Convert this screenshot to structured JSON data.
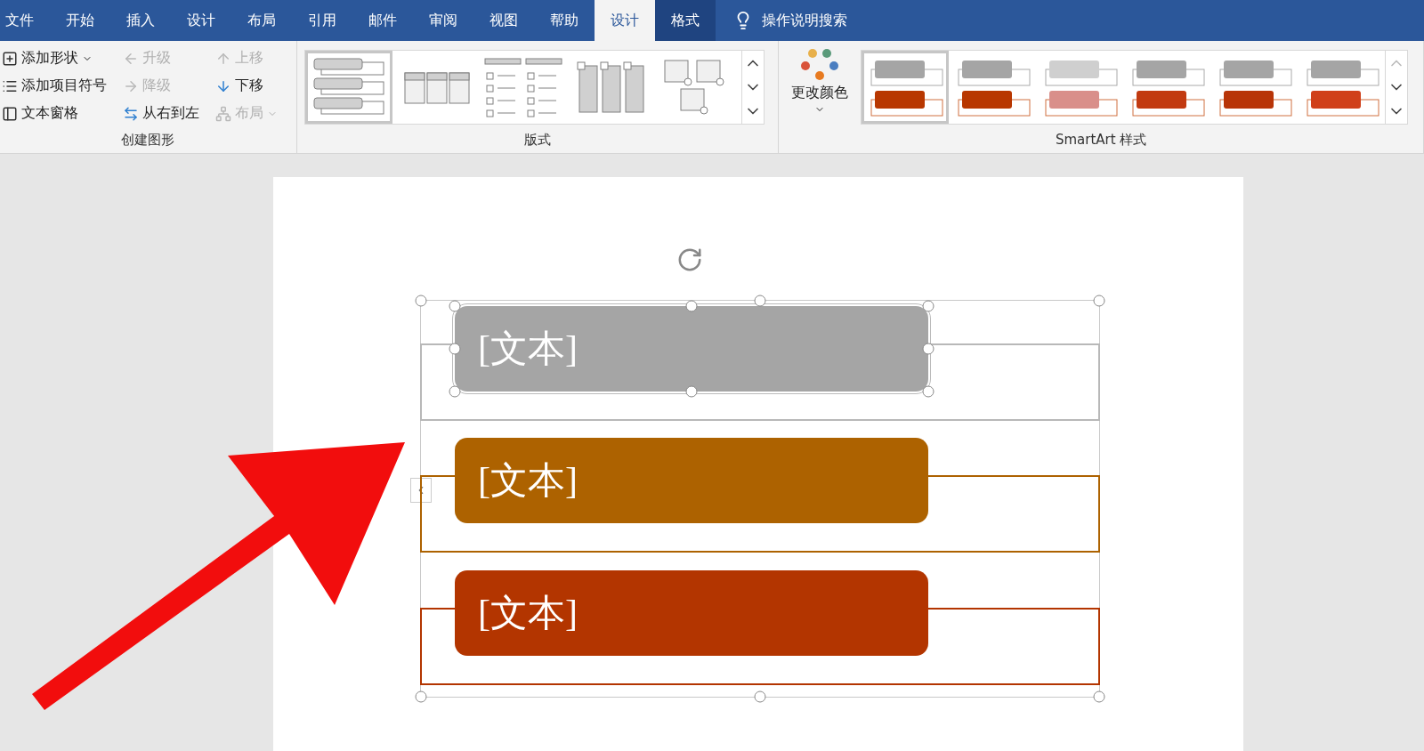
{
  "tabs": [
    {
      "label": "文件",
      "selected": false,
      "contextual": false
    },
    {
      "label": "开始",
      "selected": false,
      "contextual": false
    },
    {
      "label": "插入",
      "selected": false,
      "contextual": false
    },
    {
      "label": "设计",
      "selected": false,
      "contextual": false
    },
    {
      "label": "布局",
      "selected": false,
      "contextual": false
    },
    {
      "label": "引用",
      "selected": false,
      "contextual": false
    },
    {
      "label": "邮件",
      "selected": false,
      "contextual": false
    },
    {
      "label": "审阅",
      "selected": false,
      "contextual": false
    },
    {
      "label": "视图",
      "selected": false,
      "contextual": false
    },
    {
      "label": "帮助",
      "selected": false,
      "contextual": false
    },
    {
      "label": "设计",
      "selected": true,
      "contextual": true
    },
    {
      "label": "格式",
      "selected": false,
      "contextual": true
    }
  ],
  "search": {
    "placeholder": "操作说明搜索"
  },
  "create_graphic": {
    "label": "创建图形",
    "commands": [
      {
        "label": "添加形状",
        "disabled": false,
        "dropdown": true
      },
      {
        "label": "添加项目符号",
        "disabled": false,
        "dropdown": false
      },
      {
        "label": "文本窗格",
        "disabled": false,
        "dropdown": false
      },
      {
        "label": "升级",
        "disabled": true,
        "dropdown": false
      },
      {
        "label": "降级",
        "disabled": true,
        "dropdown": false
      },
      {
        "label": "从右到左",
        "disabled": false,
        "dropdown": false
      },
      {
        "label": "上移",
        "disabled": true,
        "dropdown": false
      },
      {
        "label": "下移",
        "disabled": false,
        "dropdown": false
      },
      {
        "label": "布局",
        "disabled": true,
        "dropdown": true
      }
    ]
  },
  "layouts": {
    "label": "版式",
    "items": [
      {
        "selected": true
      },
      {
        "selected": false
      },
      {
        "selected": false
      },
      {
        "selected": false
      },
      {
        "selected": false
      }
    ]
  },
  "styles": {
    "label": "SmartArt 样式",
    "change_colors": "更改颜色",
    "items": [
      {
        "selected": true,
        "color": "#b83700"
      },
      {
        "selected": false,
        "color": "#b83700"
      },
      {
        "selected": false,
        "color": "#d98f8a"
      },
      {
        "selected": false,
        "color": "#c23a10"
      },
      {
        "selected": false,
        "color": "#b83508"
      },
      {
        "selected": false,
        "color": "#d0401a"
      }
    ]
  },
  "smartart": {
    "items": [
      {
        "text": "[文本]",
        "color": "#a5a5a5",
        "selected": true
      },
      {
        "text": "[文本]",
        "color": "#ad6200",
        "selected": false
      },
      {
        "text": "[文本]",
        "color": "#b33500",
        "selected": false
      }
    ]
  }
}
